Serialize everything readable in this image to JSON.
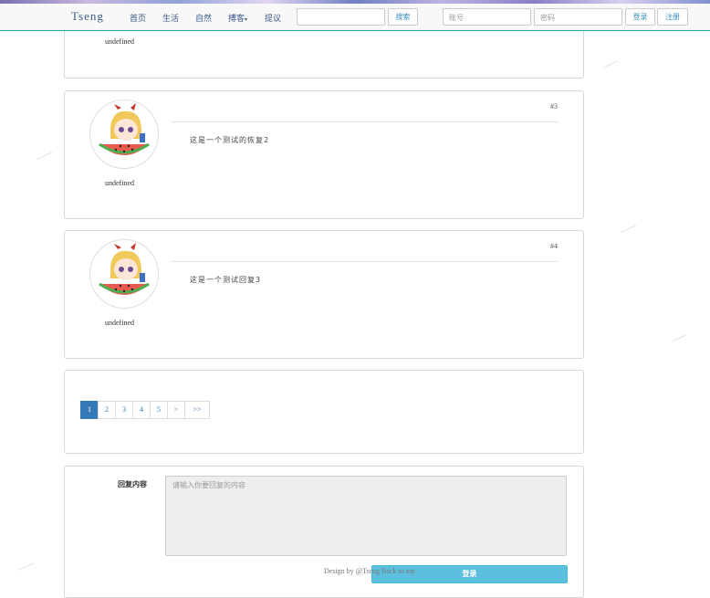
{
  "navbar": {
    "brand": "Tseng",
    "links": [
      "首页",
      "生活",
      "自然",
      "搏客"
    ],
    "suggest": "提议",
    "search_button": "搜索",
    "username_placeholder": "账号",
    "password_placeholder": "密码",
    "login_button": "登录",
    "register_button": "注册"
  },
  "top_post": {
    "username": "undefined"
  },
  "posts": [
    {
      "floor": "#3",
      "username": "undefined",
      "content": "这是一个测试的恢复2"
    },
    {
      "floor": "#4",
      "username": "undefined",
      "content": "这是一个测试回复3"
    }
  ],
  "pagination": {
    "pages": [
      "1",
      "2",
      "3",
      "4",
      "5",
      ">",
      ">>"
    ],
    "active": "1"
  },
  "reply": {
    "label": "回复内容",
    "placeholder": "请输入你要回复的内容",
    "submit": "登录"
  },
  "footer": {
    "text": "Design by @Tseng Back to top"
  },
  "colors": {
    "accent": "#337ab7",
    "submit": "#5bc0de",
    "nav_border": "#20a0c0"
  },
  "icons": {
    "avatar": "anime-girl-watermelon-avatar"
  }
}
